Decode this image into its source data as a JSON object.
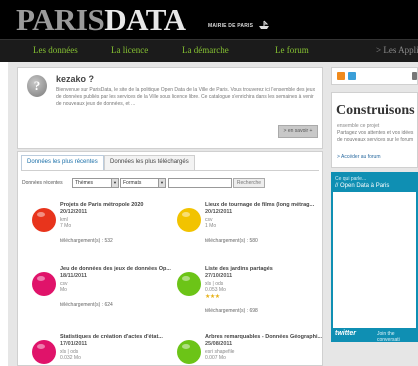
{
  "header": {
    "logo_part1": "PARIS",
    "logo_part2": "DATA",
    "tagline": "MAIRIE DE PARIS"
  },
  "nav": {
    "items": [
      "Les données",
      "La licence",
      "La démarche",
      "Le forum",
      "> Les Appli"
    ]
  },
  "intro": {
    "title": "kezako ?",
    "body": "Bienvenue sur ParisData, le site de la politique Open Data de la Ville de Paris. Vous trouverez ici l'ensemble des jeux de données publiés par les services de la Ville sous licence libre. Ce catalogue s'enrichira dans les semaines à venir de nouveaux jeux de données, et ...",
    "more_label": "> en savoir +"
  },
  "tabs": {
    "recent": "Données les plus récentes",
    "downloaded": "Données les plus téléchargés"
  },
  "filters": {
    "label": "Données récentes",
    "themes": "Thèmes",
    "formats": "Formats",
    "search_placeholder": "",
    "search_button": "Recherche"
  },
  "datasets": [
    {
      "title": "Projets de Paris métropole 2020",
      "date": "20/12/2011",
      "format": "kml",
      "size": "7 Mo",
      "downloads": "téléchargement(s) : 532",
      "color": "#e8341c"
    },
    {
      "title": "Lieux de tournage de films (long métrag...",
      "date": "20/12/2011",
      "format": "csv",
      "size": "1 Mo",
      "downloads": "téléchargement(s) : 580",
      "color": "#f2c300"
    },
    {
      "title": "Jeu de données des jeux de données Op...",
      "date": "18/11/2011",
      "format": "csv",
      "size": "Mo",
      "downloads": "téléchargement(s) : 624",
      "color": "#e0136a"
    },
    {
      "title": "Liste des jardins partagés",
      "date": "27/10/2011",
      "format": "xls | ods",
      "size": "0.053 Mo",
      "stars": "★★★",
      "downloads": "téléchargement(s) : 698",
      "color": "#6cc417"
    },
    {
      "title": "Statistiques de création d'actes d'état...",
      "date": "17/01/2011",
      "format": "xls | ods",
      "size": "0.032 Mo",
      "color": "#e0136a"
    },
    {
      "title": "Arbres remarquables - Données Géographi...",
      "date": "25/08/2011",
      "format": "esri shapefile",
      "size": "0.007 Mo",
      "color": "#6cc417"
    }
  ],
  "sidebar": {
    "promo_title": "Construisons",
    "promo_sub": "ensemble ce projet",
    "promo_body": "Partagez vos attentes et vos idées de nouveaux services sur le forum",
    "promo_link": "> Accéder au forum",
    "twitter_head1": "Ce qui parle...",
    "twitter_head2": "// Open Data à Paris",
    "twitter_logo": "twitter",
    "twitter_join": "Join the conversati"
  },
  "colors": {
    "nav_green": "#86c232",
    "twitter_blue": "#0f8fb3",
    "header_bg": "#000000"
  }
}
